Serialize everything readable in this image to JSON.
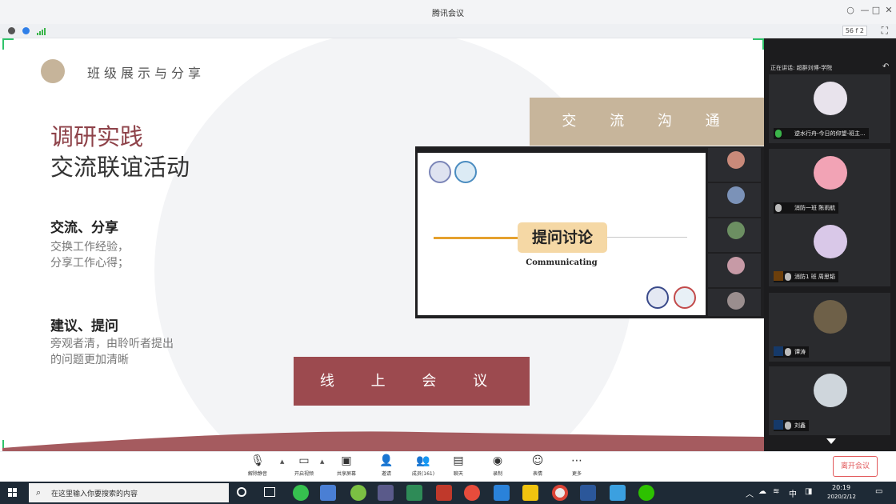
{
  "window": {
    "title": "腾讯会议"
  },
  "status": {
    "fps": "56 f 2"
  },
  "slide": {
    "section_title": "班级展示与分享",
    "heading_line1": "调研实践",
    "heading_line2": "交流联谊活动",
    "point1_title": "交流、分享",
    "point1_line1": "交换工作经验，",
    "point1_line2": "分享工作心得；",
    "point2_title": "建议、提问",
    "point2_line1": "旁观者清，由聆听者提出",
    "point2_line2": "的问题更加清晰",
    "box_communication": "交 流 沟 通",
    "box_online": "线 上 会 议",
    "embedded": {
      "label": "提问讨论",
      "sublabel": "Communicating"
    }
  },
  "panel": {
    "header": "正在讲话: 超群刘博-学院",
    "participants": [
      {
        "name": "逆水行舟-今日的仰望-班主..."
      },
      {
        "name": "消防一班 陈雨航"
      },
      {
        "name": "消防1 班 周思韬"
      },
      {
        "name": "谭涛"
      },
      {
        "name": "刘鑫"
      }
    ]
  },
  "toolbar": {
    "buttons": [
      {
        "label": "解除静音",
        "icon": "mic-muted-icon"
      },
      {
        "label": "开启视频",
        "icon": "camera-off-icon"
      },
      {
        "label": "共享屏幕",
        "icon": "screen-share-icon"
      },
      {
        "label": "邀请",
        "icon": "invite-icon"
      },
      {
        "label": "成员(161)",
        "icon": "members-icon"
      },
      {
        "label": "聊天",
        "icon": "chat-icon"
      },
      {
        "label": "录制",
        "icon": "record-icon"
      },
      {
        "label": "表情",
        "icon": "emoji-icon"
      },
      {
        "label": "更多",
        "icon": "more-icon"
      }
    ],
    "leave": "离开会议"
  },
  "taskbar": {
    "search_placeholder": "在这里输入你要搜索的内容",
    "ime": "中",
    "time": "20:19",
    "date": "2020/2/12"
  }
}
